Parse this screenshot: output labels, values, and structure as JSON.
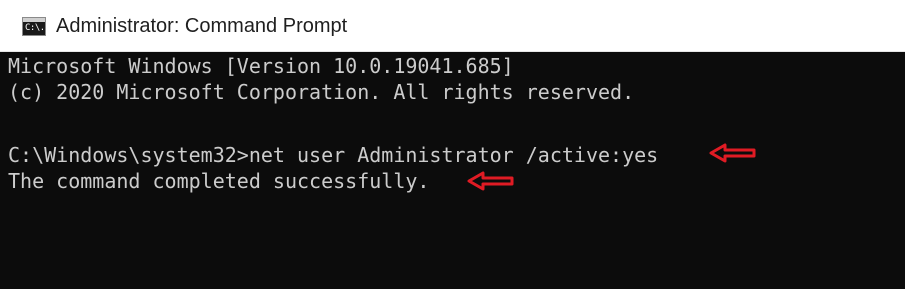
{
  "window": {
    "title": "Administrator: Command Prompt",
    "icon": "cmd-app-icon",
    "icon_glyph": "C:\\."
  },
  "console": {
    "lines": [
      "Microsoft Windows [Version 10.0.19041.685]",
      "(c) 2020 Microsoft Corporation. All rights reserved.",
      "",
      "C:\\Windows\\system32>net user Administrator /active:yes",
      "The command completed successfully."
    ],
    "text_color": "#cccccc",
    "background_color": "#0c0c0c"
  },
  "annotations": {
    "arrow_color": "#e01b24",
    "arrow_icon": "left-arrow-icon"
  }
}
